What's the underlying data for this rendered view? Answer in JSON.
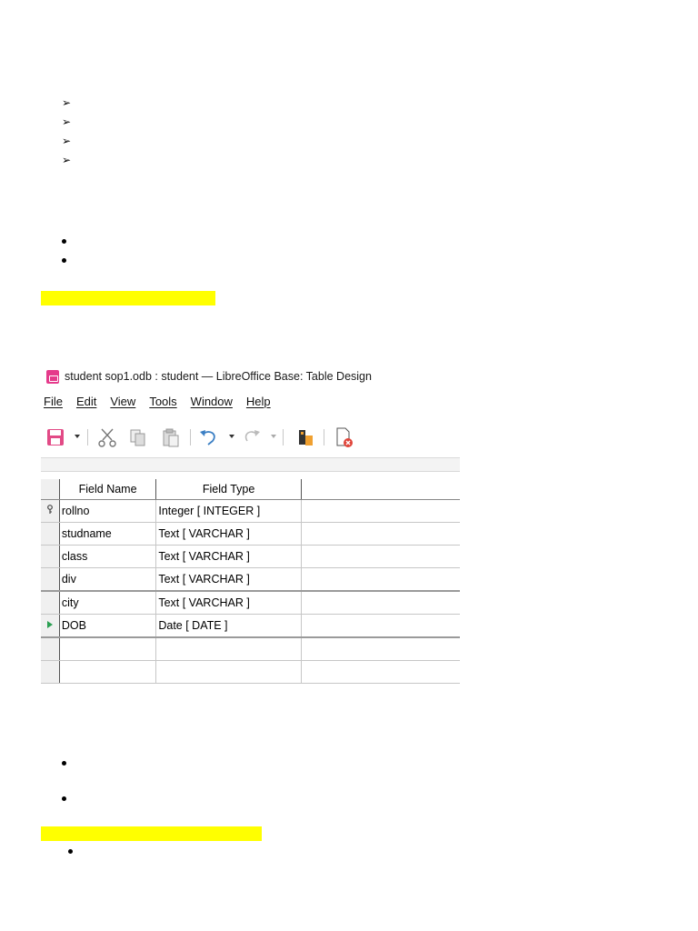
{
  "window": {
    "title": "student sop1.odb : student — LibreOffice Base: Table Design"
  },
  "menu": [
    {
      "label": "File"
    },
    {
      "label": "Edit"
    },
    {
      "label": "View"
    },
    {
      "label": "Tools"
    },
    {
      "label": "Window"
    },
    {
      "label": "Help"
    }
  ],
  "toolbar": {
    "icons": [
      "save-icon",
      "cut-icon",
      "copy-icon",
      "paste-icon",
      "undo-icon",
      "redo-icon",
      "index-design-icon",
      "close-document-icon"
    ]
  },
  "table": {
    "columns": [
      "Field Name",
      "Field Type",
      ""
    ],
    "rows": [
      {
        "marker": "primary-key-icon",
        "name": "rollno",
        "type": "Integer [ INTEGER ]"
      },
      {
        "marker": "",
        "name": "studname",
        "type": "Text [ VARCHAR ]"
      },
      {
        "marker": "",
        "name": "class",
        "type": "Text [ VARCHAR ]"
      },
      {
        "marker": "",
        "name": "div",
        "type": "Text [ VARCHAR ]"
      },
      {
        "marker": "",
        "name": "city",
        "type": "Text [ VARCHAR ]"
      },
      {
        "marker": "current-row-icon",
        "name": "DOB",
        "type": "Date [ DATE ]"
      },
      {
        "marker": "",
        "name": "",
        "type": ""
      },
      {
        "marker": "",
        "name": "",
        "type": ""
      }
    ]
  },
  "colors": {
    "highlight": "#ffff00",
    "app_icon": "#e53a8b",
    "current_row_marker": "#2aa052"
  }
}
